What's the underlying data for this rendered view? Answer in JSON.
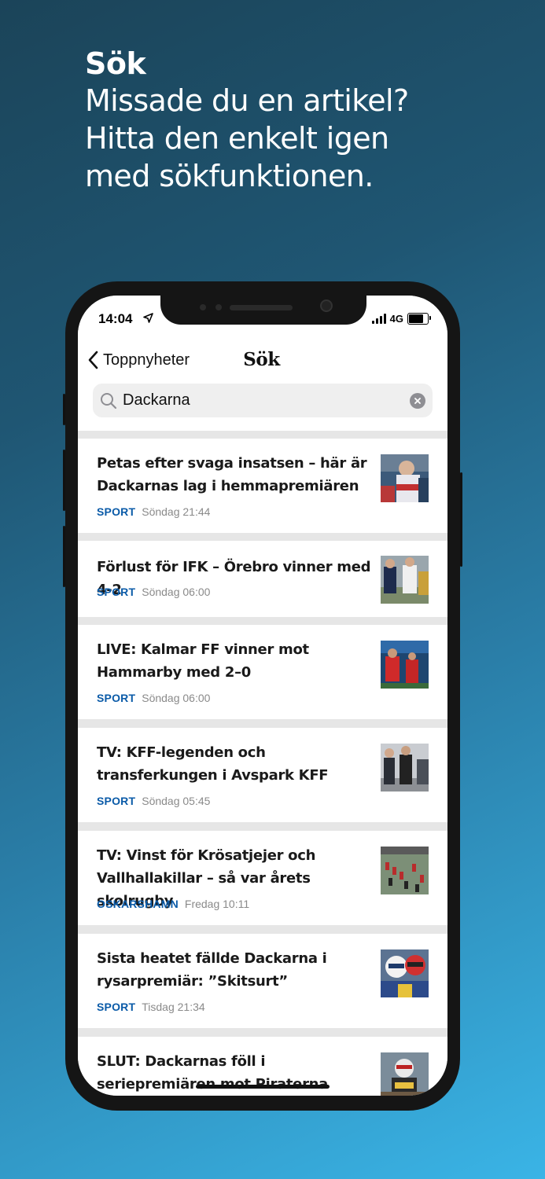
{
  "headline": {
    "title": "Sök",
    "line1": "Missade du en artikel?",
    "line2": "Hitta den enkelt igen",
    "line3": "med sökfunktionen."
  },
  "status": {
    "time": "14:04",
    "network": "4G"
  },
  "nav": {
    "back_label": "Toppnyheter",
    "title": "Sök"
  },
  "search": {
    "value": "Dackarna"
  },
  "articles": [
    {
      "title": "Petas efter svaga insatsen – här är Dackarnas lag i hemmapremiären",
      "category": "SPORT",
      "time": "Söndag 21:44",
      "thumb_icon": "speedway-rider-photo"
    },
    {
      "title": "Förlust för IFK – Örebro vinner med 4-2",
      "category": "SPORT",
      "time": "Söndag 06:00",
      "thumb_icon": "football-players-photo"
    },
    {
      "title": "LIVE: Kalmar FF vinner mot Hammarby med 2–0",
      "category": "SPORT",
      "time": "Söndag 06:00",
      "thumb_icon": "football-match-photo"
    },
    {
      "title": "TV: KFF-legenden och transferkungen i Avspark KFF",
      "category": "SPORT",
      "time": "Söndag 05:45",
      "thumb_icon": "interview-photo"
    },
    {
      "title": "TV: Vinst för Krösatjejer och Vallhallakillar – så var årets skolrugby",
      "category": "OSKARSHAMN",
      "time": "Fredag 10:11",
      "thumb_icon": "rugby-field-photo"
    },
    {
      "title": "Sista heatet fällde Dackarna i rysarpremiär: ”Skitsurt”",
      "category": "SPORT",
      "time": "Tisdag 21:34",
      "thumb_icon": "speedway-helmets-photo"
    },
    {
      "title": "SLUT: Dackarnas föll i seriepremiären mot Piraterna",
      "category": "",
      "time": "",
      "thumb_icon": "speedway-race-photo"
    }
  ]
}
